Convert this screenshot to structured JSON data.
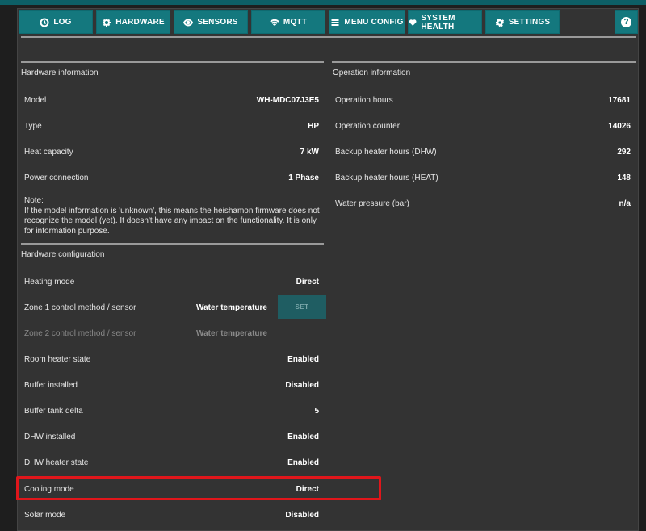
{
  "nav": {
    "buttons": [
      {
        "label": "LOG",
        "icon": "clock-icon"
      },
      {
        "label": "HARDWARE",
        "icon": "chip-icon"
      },
      {
        "label": "SENSORS",
        "icon": "eye-icon"
      },
      {
        "label": "MQTT",
        "icon": "wifi-icon"
      },
      {
        "label": "MENU CONFIG",
        "icon": "menu-icon"
      },
      {
        "label": "SYSTEM HEALTH",
        "icon": "heart-icon"
      },
      {
        "label": "SETTINGS",
        "icon": "gear-icon"
      }
    ],
    "help_label": "?"
  },
  "hardware_info": {
    "title": "Hardware information",
    "rows": [
      {
        "label": "Model",
        "value": "WH-MDC07J3E5"
      },
      {
        "label": "Type",
        "value": "HP"
      },
      {
        "label": "Heat capacity",
        "value": "7 kW"
      },
      {
        "label": "Power connection",
        "value": "1 Phase"
      }
    ],
    "note": "Note:\nIf the model information is 'unknown', this means the heishamon firmware does not recognize the model (yet). It doesn't have any impact on the functionality. It is only for information purpose."
  },
  "operation_info": {
    "title": "Operation information",
    "rows": [
      {
        "label": "Operation hours",
        "value": "17681"
      },
      {
        "label": "Operation counter",
        "value": "14026"
      },
      {
        "label": "Backup heater hours (DHW)",
        "value": "292"
      },
      {
        "label": "Backup heater hours (HEAT)",
        "value": "148"
      },
      {
        "label": "Water pressure (bar)",
        "value": "n/a"
      }
    ]
  },
  "hardware_config": {
    "title": "Hardware configuration",
    "set_label": "SET",
    "rows": [
      {
        "label": "Heating mode",
        "value": "Direct"
      },
      {
        "label": "Zone 1 control method / sensor",
        "value": "Water temperature"
      },
      {
        "label": "Zone 2 control method / sensor",
        "value": "Water temperature"
      },
      {
        "label": "Room heater state",
        "value": "Enabled"
      },
      {
        "label": "Buffer installed",
        "value": "Disabled"
      },
      {
        "label": "Buffer tank delta",
        "value": "5"
      },
      {
        "label": "DHW installed",
        "value": "Enabled"
      },
      {
        "label": "DHW heater state",
        "value": "Enabled"
      },
      {
        "label": "Cooling mode",
        "value": "Direct"
      },
      {
        "label": "Solar mode",
        "value": "Disabled"
      }
    ]
  },
  "colors": {
    "accent": "#14787e",
    "highlight": "#e0161b",
    "panel": "#333333",
    "background": "#1e1e1e"
  }
}
